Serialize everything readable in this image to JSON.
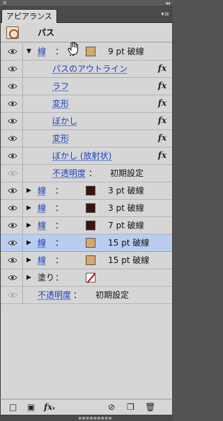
{
  "window": {
    "close_glyph": "✕",
    "collapse_glyph": "◂◂"
  },
  "tab": {
    "label": "アピアランス",
    "menu_icon": "menu-icon"
  },
  "header": {
    "title": "パス",
    "thumbnail_icon": "object-thumbnail-icon"
  },
  "rows": [
    {
      "kind": "stroke",
      "label": "線",
      "value": "9 pt 破線",
      "swatch": "#d6a86c",
      "expanded": true,
      "visible": true
    },
    {
      "kind": "effect",
      "label": "パスのアウトライン",
      "fx": "fx",
      "visible": true
    },
    {
      "kind": "effect",
      "label": "ラフ",
      "fx": "fx",
      "visible": true
    },
    {
      "kind": "effect",
      "label": "変形",
      "fx": "fx",
      "visible": true
    },
    {
      "kind": "effect",
      "label": "ぼかし",
      "fx": "fx",
      "visible": true
    },
    {
      "kind": "effect",
      "label": "変形",
      "fx": "fx",
      "visible": true
    },
    {
      "kind": "effect",
      "label": "ぼかし (放射状)",
      "fx": "fx",
      "visible": true
    },
    {
      "kind": "opacity",
      "label": "不透明度",
      "value": "初期設定",
      "visible": false
    },
    {
      "kind": "stroke",
      "label": "線",
      "value": "3 pt 破線",
      "swatch": "#3a1412",
      "expanded": false,
      "visible": true
    },
    {
      "kind": "stroke",
      "label": "線",
      "value": "3 pt 破線",
      "swatch": "#3a1412",
      "expanded": false,
      "visible": true
    },
    {
      "kind": "stroke",
      "label": "線",
      "value": "7 pt 破線",
      "swatch": "#3a1412",
      "expanded": false,
      "visible": true
    },
    {
      "kind": "stroke",
      "label": "線",
      "value": "15 pt 破線",
      "swatch": "#d6a86c",
      "expanded": false,
      "visible": true,
      "selected": true
    },
    {
      "kind": "stroke",
      "label": "線",
      "value": "15 pt 破線",
      "swatch": "#d6a86c",
      "expanded": false,
      "visible": true
    },
    {
      "kind": "fill",
      "label": "塗り",
      "swatch": "none",
      "expanded": false,
      "visible": true
    },
    {
      "kind": "opacity",
      "label": "不透明度",
      "value": "初期設定",
      "visible": false,
      "root": true
    }
  ],
  "colon": "：",
  "footer": {
    "icons": [
      "add-new-stroke-icon",
      "add-new-fill-icon",
      "add-new-effect-icon",
      "clear-appearance-icon",
      "duplicate-item-icon",
      "delete-item-icon"
    ],
    "fx_label": "fx"
  },
  "grip": "▪▪▪▪▪▪▪▪▪"
}
